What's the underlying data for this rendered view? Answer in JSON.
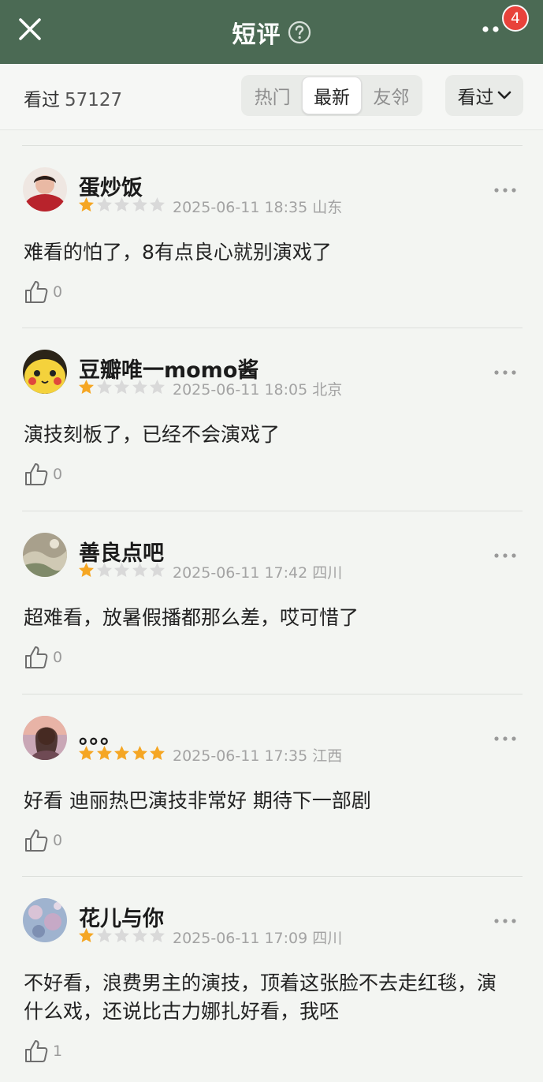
{
  "header": {
    "title": "短评",
    "notification_count": "4",
    "bg_color": "#4b6a54"
  },
  "filter": {
    "watched_label": "看过",
    "watched_count": "57127",
    "tabs": [
      "热门",
      "最新",
      "友邻"
    ],
    "active_tab": "最新",
    "dropdown_label": "看过"
  },
  "reviews": [
    {
      "username": "蛋炒饭",
      "rating": 1,
      "date": "2025-06-11 18:35",
      "location": "山东",
      "content": "难看的怕了，8有点良心就别演戏了",
      "likes": "0",
      "avatar_icon": "person-photo-icon"
    },
    {
      "username": "豆瓣唯一momo酱",
      "rating": 1,
      "date": "2025-06-11 18:05",
      "location": "北京",
      "content": "演技刻板了，已经不会演戏了",
      "likes": "0",
      "avatar_icon": "pikachu-icon"
    },
    {
      "username": "善良点吧",
      "rating": 1,
      "date": "2025-06-11 17:42",
      "location": "四川",
      "content": "超难看，放暑假播都那么差，哎可惜了",
      "likes": "0",
      "avatar_icon": "landscape-photo-icon"
    },
    {
      "username": "。。。",
      "rating": 5,
      "date": "2025-06-11 17:35",
      "location": "江西",
      "content": "好看 迪丽热巴演技非常好 期待下一部剧",
      "likes": "0",
      "avatar_icon": "portrait-photo-icon"
    },
    {
      "username": "花儿与你",
      "rating": 1,
      "date": "2025-06-11 17:09",
      "location": "四川",
      "content": "不好看，浪费男主的演技，顶着这张脸不去走红毯，演什么戏，还说比古力娜扎好看，我呸",
      "likes": "1",
      "avatar_icon": "flower-photo-icon"
    }
  ],
  "colors": {
    "star_filled": "#f5a623",
    "star_empty": "#d9d9d9"
  }
}
